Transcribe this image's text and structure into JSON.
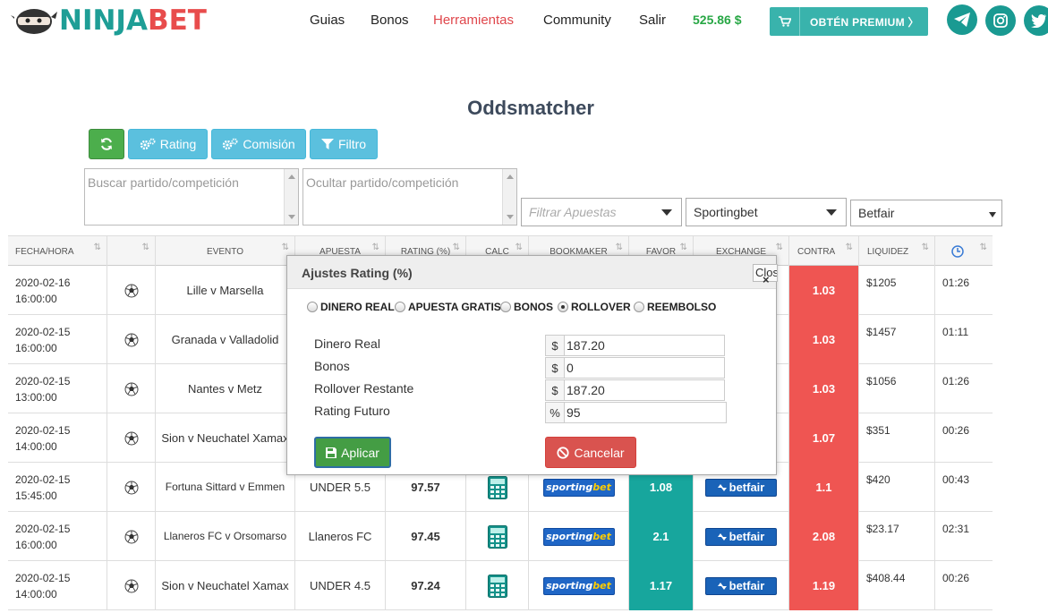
{
  "brand": {
    "part1": "NINJA",
    "part2": "BET"
  },
  "nav": [
    {
      "label": "Guias",
      "active": false
    },
    {
      "label": "Bonos",
      "active": false
    },
    {
      "label": "Herramientas",
      "active": true
    },
    {
      "label": "Community",
      "active": false
    },
    {
      "label": "Salir",
      "active": false
    }
  ],
  "balance": "525.86 $",
  "premium_label": "OBTÉN PREMIUM 〉",
  "social": [
    "telegram-icon",
    "instagram-icon",
    "twitter-icon"
  ],
  "page_title": "Oddsmatcher",
  "toolbar": {
    "refresh_icon": "refresh-icon",
    "rating": "Rating",
    "comision": "Comisión",
    "filtro": "Filtro"
  },
  "filters": {
    "search_placeholder": "Buscar partido/competición",
    "hide_placeholder": "Ocultar partido/competición",
    "bets_placeholder": "Filtrar Apuestas",
    "bookmaker": "Sportingbet",
    "exchange": "Betfair"
  },
  "table": {
    "headers": [
      "FECHA/HORA",
      "",
      "EVENTO",
      "APUESTA",
      "RATING (%)",
      "CALC",
      "BOOKMAKER",
      "FAVOR",
      "EXCHANGE",
      "CONTRA",
      "LIQUIDEZ",
      ""
    ],
    "rows": [
      {
        "date": "2020-02-16",
        "time": "16:00:00",
        "event": "Lille v Marsella",
        "bet": "",
        "rating": "",
        "favor": "",
        "contra": "1.03",
        "liquidez": "$1205",
        "timer": "01:26"
      },
      {
        "date": "2020-02-15",
        "time": "16:00:00",
        "event": "Granada v Valladolid",
        "bet": "",
        "rating": "",
        "favor": "",
        "contra": "1.03",
        "liquidez": "$1457",
        "timer": "01:11"
      },
      {
        "date": "2020-02-15",
        "time": "13:00:00",
        "event": "Nantes v Metz",
        "bet": "",
        "rating": "",
        "favor": "",
        "contra": "1.03",
        "liquidez": "$1056",
        "timer": "01:26"
      },
      {
        "date": "2020-02-15",
        "time": "14:00:00",
        "event": "Sion v Neuchatel Xamax",
        "bet": "",
        "rating": "",
        "favor": "",
        "contra": "1.07",
        "liquidez": "$351",
        "timer": "00:26"
      },
      {
        "date": "2020-02-15",
        "time": "15:45:00",
        "event": "Fortuna Sittard v Emmen",
        "bet": "UNDER 5.5",
        "rating": "97.57",
        "favor": "1.08",
        "contra": "1.1",
        "liquidez": "$420",
        "timer": "00:43"
      },
      {
        "date": "2020-02-15",
        "time": "16:00:00",
        "event": "Llaneros FC v Orsomarso",
        "bet": "Llaneros FC",
        "rating": "97.45",
        "favor": "2.1",
        "contra": "2.08",
        "liquidez": "$23.17",
        "timer": "02:31"
      },
      {
        "date": "2020-02-15",
        "time": "14:00:00",
        "event": "Sion v Neuchatel Xamax",
        "bet": "UNDER 4.5",
        "rating": "97.24",
        "favor": "1.17",
        "contra": "1.19",
        "liquidez": "$408.44",
        "timer": "00:26"
      }
    ],
    "bookmaker_logo": {
      "a": "sporting",
      "b": "bet"
    },
    "exchange_logo": "betfair"
  },
  "modal": {
    "title": "Ajustes Rating (%)",
    "close_label": "Close",
    "options": [
      {
        "label": "DINERO REAL",
        "selected": false
      },
      {
        "label": "APUESTA GRATIS",
        "selected": false
      },
      {
        "label": "BONOS",
        "selected": false
      },
      {
        "label": "ROLLOVER",
        "selected": true
      },
      {
        "label": "REEMBOLSO",
        "selected": false
      }
    ],
    "fields": [
      {
        "label": "Dinero Real",
        "addon": "$",
        "value": "187.20"
      },
      {
        "label": "Bonos",
        "addon": "$",
        "value": "0"
      },
      {
        "label": "Rollover Restante",
        "addon": "$",
        "value": "187.20"
      },
      {
        "label": "Rating Futuro",
        "addon": "%",
        "value": "95"
      }
    ],
    "apply": "Aplicar",
    "cancel": "Cancelar"
  },
  "colors": {
    "brand_teal": "#1e9e96",
    "brand_red": "#e84c4c",
    "favor": "#17a69d",
    "contra": "#ef5552",
    "balance": "#28a745"
  }
}
